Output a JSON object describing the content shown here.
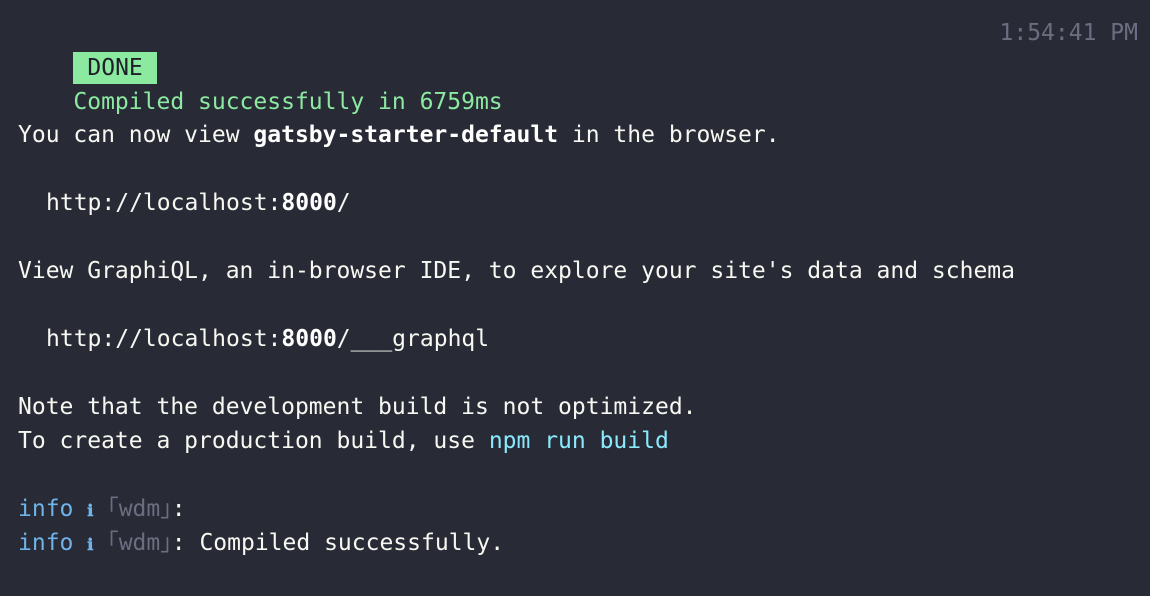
{
  "status": {
    "badge": "DONE",
    "message": "Compiled successfully in 6759ms",
    "timestamp": "1:54:41 PM"
  },
  "view": {
    "prefix": "You can now view ",
    "project": "gatsby-starter-default",
    "suffix": " in the browser."
  },
  "local_url": {
    "host": "http://localhost:",
    "port": "8000",
    "path": "/"
  },
  "graphiql": {
    "text": "View GraphiQL, an in-browser IDE, to explore your site's data and schema"
  },
  "graphql_url": {
    "host": "http://localhost:",
    "port": "8000",
    "path": "/___graphql"
  },
  "note": {
    "line1": "Note that the development build is not optimized.",
    "line2_prefix": "To create a production build, use ",
    "command": "npm run build"
  },
  "logs": [
    {
      "level": "info",
      "icon": "ℹ",
      "source": "｢wdm｣",
      "sep": ":",
      "message": ""
    },
    {
      "level": "info",
      "icon": "ℹ",
      "source": "｢wdm｣",
      "sep": ":",
      "message": " Compiled successfully."
    }
  ],
  "colors": {
    "background": "#282a36",
    "success": "#8be9a0",
    "link": "#8be9fd",
    "info": "#6fb3e8",
    "dim": "#6b6e80"
  }
}
